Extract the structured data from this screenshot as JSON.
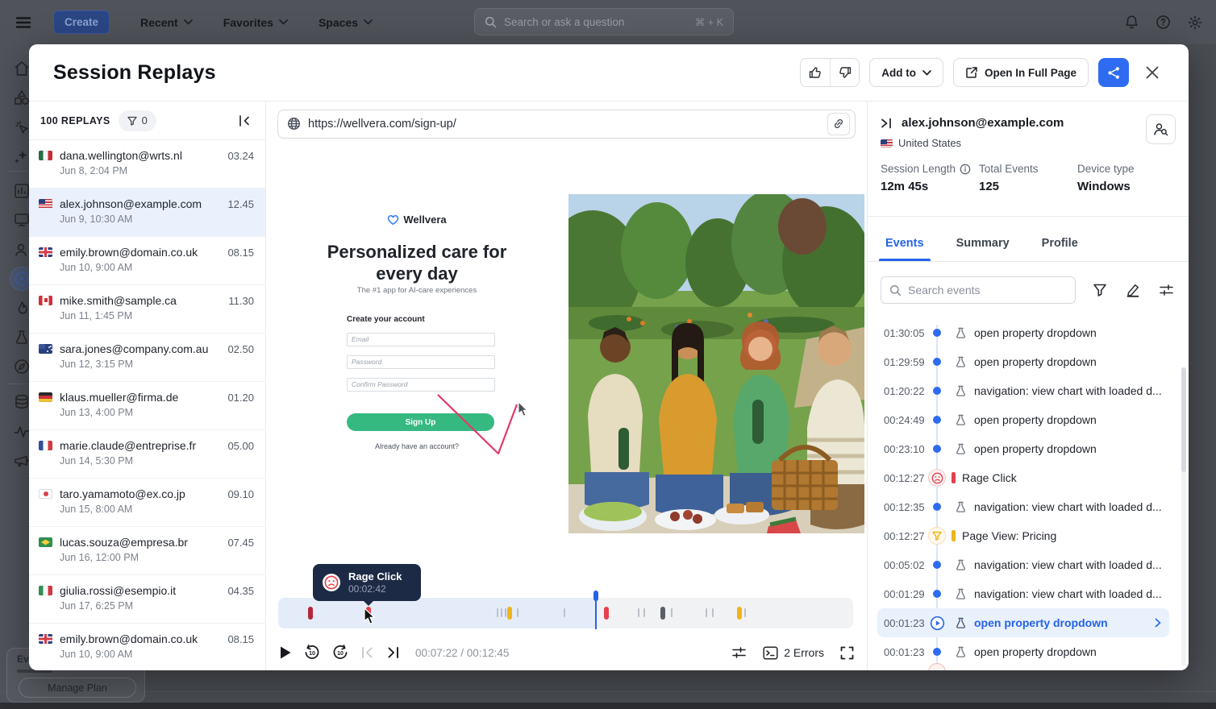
{
  "topbar": {
    "create": "Create",
    "recent": "Recent",
    "favorites": "Favorites",
    "spaces": "Spaces",
    "search_placeholder": "Search or ask a question",
    "search_shortcut": "⌘ + K"
  },
  "backdrop": {
    "usage_label": "Ev",
    "manage_plan": "Manage Plan"
  },
  "modal": {
    "title": "Session Replays",
    "add_to_label": "Add to",
    "open_full_label": "Open In Full Page"
  },
  "replays": {
    "count_label": "100 REPLAYS",
    "filter_count": "0",
    "items": [
      {
        "flag": "mx",
        "email": "dana.wellington@wrts.nl",
        "date": "Jun 8, 2:04 PM",
        "duration": "03.24"
      },
      {
        "flag": "us",
        "email": "alex.johnson@example.com",
        "date": "Jun 9, 10:30 AM",
        "duration": "12.45"
      },
      {
        "flag": "gb",
        "email": "emily.brown@domain.co.uk",
        "date": "Jun 10, 9:00 AM",
        "duration": "08.15"
      },
      {
        "flag": "ca",
        "email": "mike.smith@sample.ca",
        "date": "Jun 11, 1:45 PM",
        "duration": "11.30"
      },
      {
        "flag": "au",
        "email": "sara.jones@company.com.au",
        "date": "Jun 12, 3:15 PM",
        "duration": "02.50"
      },
      {
        "flag": "de",
        "email": "klaus.mueller@firma.de",
        "date": "Jun 13, 4:00 PM",
        "duration": "01.20"
      },
      {
        "flag": "fr",
        "email": "marie.claude@entreprise.fr",
        "date": "Jun 14, 5:30 PM",
        "duration": "05.00"
      },
      {
        "flag": "jp",
        "email": "taro.yamamoto@ex.co.jp",
        "date": "Jun 15, 8:00 AM",
        "duration": "09.10"
      },
      {
        "flag": "br",
        "email": "lucas.souza@empresa.br",
        "date": "Jun 16, 12:00 PM",
        "duration": "07.45"
      },
      {
        "flag": "it",
        "email": "giulia.rossi@esempio.it",
        "date": "Jun 17, 6:25 PM",
        "duration": "04.35"
      },
      {
        "flag": "gb",
        "email": "emily.brown@domain.co.uk",
        "date": "Jun 10, 9:00 AM",
        "duration": "08.15"
      }
    ]
  },
  "player": {
    "url": "https://wellvera.com/sign-up/",
    "time": "00:07:22 / 00:12:45",
    "errors_label": "2 Errors",
    "tooltip": {
      "title": "Rage Click",
      "time": "00:02:42"
    },
    "page": {
      "brand": "Wellvera",
      "heading": "Personalized care for every day",
      "subtitle": "The #1 app for AI-care experiences",
      "form_label": "Create your account",
      "email_placeholder": "Email",
      "password_placeholder": "Password",
      "confirm_placeholder": "Confirm Password",
      "cta": "Sign Up",
      "signin": "Already have an account?"
    },
    "timeline": {
      "playhead_pct": 55.3,
      "markers": [
        {
          "p": 5.6,
          "t": "pill",
          "c": "#b3273a"
        },
        {
          "p": 15.7,
          "t": "pill",
          "c": "#e5404d"
        },
        {
          "p": 38.1,
          "t": "tick"
        },
        {
          "p": 38.8,
          "t": "tick"
        },
        {
          "p": 39.5,
          "t": "tick"
        },
        {
          "p": 40.3,
          "t": "pill",
          "c": "#f0b41c"
        },
        {
          "p": 41.6,
          "t": "tick"
        },
        {
          "p": 49.8,
          "t": "tick"
        },
        {
          "p": 57.1,
          "t": "pill",
          "c": "#e5404d"
        },
        {
          "p": 62.7,
          "t": "tick"
        },
        {
          "p": 63.7,
          "t": "tick"
        },
        {
          "p": 66.9,
          "t": "pill",
          "c": "#5b6066"
        },
        {
          "p": 68.4,
          "t": "tick"
        },
        {
          "p": 74.5,
          "t": "tick"
        },
        {
          "p": 75.6,
          "t": "tick"
        },
        {
          "p": 80.2,
          "t": "pill",
          "c": "#f0b41c"
        },
        {
          "p": 81.2,
          "t": "tick"
        }
      ]
    }
  },
  "session": {
    "email": "alex.johnson@example.com",
    "country": "United States",
    "country_flag": "us",
    "stats": [
      {
        "label": "Session Length",
        "value": "12m 45s"
      },
      {
        "label": "Total Events",
        "value": "125"
      },
      {
        "label": "Device type",
        "value": "Windows"
      }
    ],
    "tabs": [
      {
        "label": "Events"
      },
      {
        "label": "Summary"
      },
      {
        "label": "Profile"
      }
    ],
    "search_placeholder": "Search events",
    "events": [
      {
        "time": "01:30:05",
        "label": "open property dropdown",
        "type": "dot"
      },
      {
        "time": "01:29:59",
        "label": "open property dropdown",
        "type": "dot"
      },
      {
        "time": "01:20:22",
        "label": "navigation: view chart with loaded d...",
        "type": "dot"
      },
      {
        "time": "00:24:49",
        "label": "open property dropdown",
        "type": "dot"
      },
      {
        "time": "00:23:10",
        "label": "open property dropdown",
        "type": "dot"
      },
      {
        "time": "00:12:27",
        "label": "Rage Click",
        "type": "rage"
      },
      {
        "time": "00:12:35",
        "label": "navigation: view chart with loaded d...",
        "type": "dot"
      },
      {
        "time": "00:12:27",
        "label": "Page View: Pricing",
        "type": "pageview"
      },
      {
        "time": "00:05:02",
        "label": "navigation: view chart with loaded d...",
        "type": "dot"
      },
      {
        "time": "00:01:29",
        "label": "navigation: view chart with loaded d...",
        "type": "dot"
      },
      {
        "time": "00:01:23",
        "label": "open property dropdown",
        "type": "selected"
      },
      {
        "time": "00:01:23",
        "label": "open property dropdown",
        "type": "dot"
      }
    ]
  }
}
